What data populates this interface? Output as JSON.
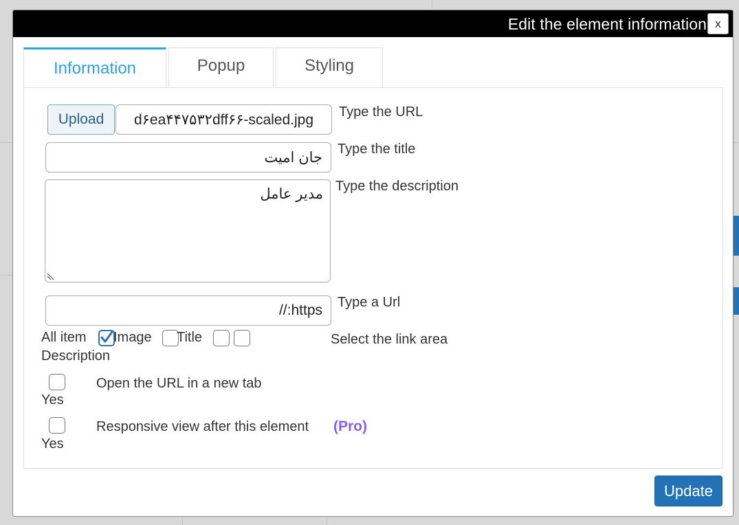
{
  "modal": {
    "title": "Edit the element information",
    "close_label": "x",
    "update_label": "Update"
  },
  "tabs": [
    {
      "label": "Information",
      "active": true
    },
    {
      "label": "Popup",
      "active": false
    },
    {
      "label": "Styling",
      "active": false
    }
  ],
  "form": {
    "url": {
      "upload_label": "Upload",
      "value": "d۶ea۴۴۷۵۳۲dff۶۶-scaled.jpg",
      "label": "Type the URL"
    },
    "title": {
      "value": "جان امیت",
      "label": "Type the title"
    },
    "description": {
      "value": "مدیر عامل",
      "label": "Type the description"
    },
    "link_url": {
      "value": "//:https",
      "label": "Type a Url"
    },
    "link_area": {
      "label": "Select the link area",
      "options": [
        {
          "label": "All item",
          "checked": false
        },
        {
          "label": "Image",
          "checked": true
        },
        {
          "label": "Title",
          "checked": false
        },
        {
          "label": "Description",
          "checked": false
        }
      ]
    },
    "new_tab": {
      "label": "Open the URL in a new tab",
      "option_label": "Yes",
      "checked": false
    },
    "responsive": {
      "label": "Responsive view after this element",
      "option_label": "Yes",
      "badge": "(Pro)",
      "checked": false
    }
  },
  "colors": {
    "header_bg": "#000000",
    "tab_active": "#2c9fdf",
    "primary_button": "#2472b6",
    "pro_badge": "#8b5cf6"
  }
}
